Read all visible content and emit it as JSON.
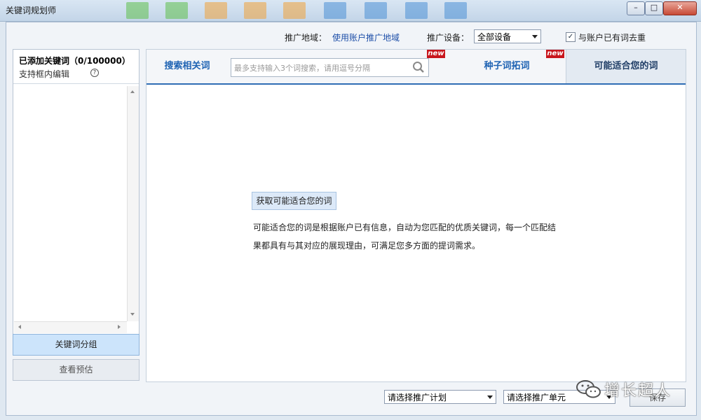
{
  "window": {
    "title": "关键词规划师",
    "minimize": "–",
    "maximize": "□",
    "close": "✕"
  },
  "options": {
    "region_label": "推广地域：",
    "region_value": "使用账户推广地域",
    "device_label": "推广设备：",
    "device_value": "全部设备",
    "dedupe_checked": "✓",
    "dedupe_label": "与账户已有词去重"
  },
  "left": {
    "added_title": "已添加关键词（0/100000）",
    "inline_edit": "支持框内编辑",
    "help_icon": "?",
    "group_button": "关键词分组",
    "preview_button": "查看预估"
  },
  "tabs": {
    "search_related": "搜索相关词",
    "search_placeholder": "最多支持输入3个词搜索，请用逗号分隔",
    "seed_expand": "种子词拓词",
    "suitable": "可能适合您的词",
    "new_tag": "new"
  },
  "content": {
    "get_button": "获取可能适合您的词",
    "description": "可能适合您的词是根据账户已有信息，自动为您匹配的优质关键词，每一个匹配结果都具有与其对应的展现理由，可满足您多方面的提词需求。"
  },
  "bottom": {
    "plan_select": "请选择推广计划",
    "unit_select": "请选择推广单元",
    "save_button": "保存"
  },
  "watermark": "增长超人",
  "colors": {
    "accent": "#1f63b3",
    "new_tag": "#c8161d",
    "group_button_bg": "#cce4fb"
  }
}
